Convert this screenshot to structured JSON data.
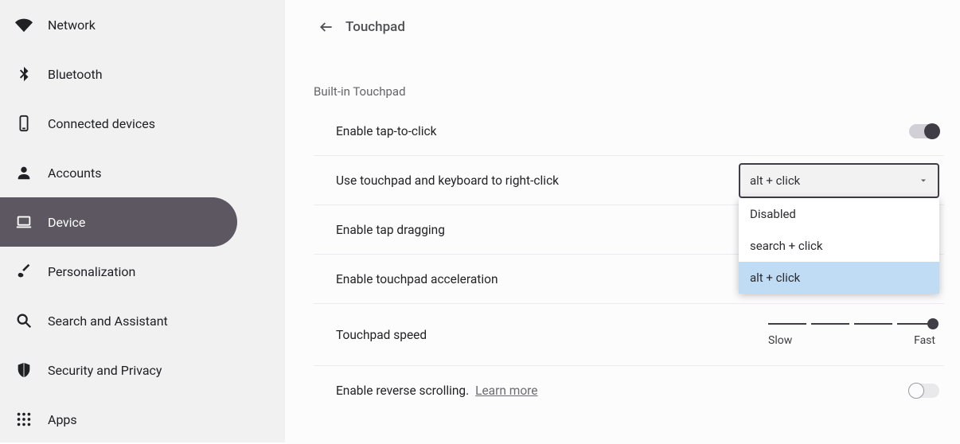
{
  "sidebar": {
    "items": [
      {
        "label": "Network",
        "icon": "wifi",
        "active": false
      },
      {
        "label": "Bluetooth",
        "icon": "bluetooth",
        "active": false
      },
      {
        "label": "Connected devices",
        "icon": "phone",
        "active": false
      },
      {
        "label": "Accounts",
        "icon": "person",
        "active": false
      },
      {
        "label": "Device",
        "icon": "laptop",
        "active": true
      },
      {
        "label": "Personalization",
        "icon": "brush",
        "active": false
      },
      {
        "label": "Search and Assistant",
        "icon": "search",
        "active": false
      },
      {
        "label": "Security and Privacy",
        "icon": "shield",
        "active": false
      },
      {
        "label": "Apps",
        "icon": "apps",
        "active": false
      }
    ]
  },
  "page": {
    "title": "Touchpad",
    "section": "Built-in Touchpad"
  },
  "settings": {
    "tap_to_click": {
      "label": "Enable tap-to-click",
      "on": true
    },
    "right_click": {
      "label": "Use touchpad and keyboard to right-click",
      "selected": "alt + click",
      "options": [
        "Disabled",
        "search + click",
        "alt + click"
      ]
    },
    "tap_dragging": {
      "label": "Enable tap dragging"
    },
    "acceleration": {
      "label": "Enable touchpad acceleration"
    },
    "speed": {
      "label": "Touchpad speed",
      "min_label": "Slow",
      "max_label": "Fast"
    },
    "reverse": {
      "label": "Enable reverse scrolling.",
      "link": "Learn more",
      "on": false
    }
  }
}
